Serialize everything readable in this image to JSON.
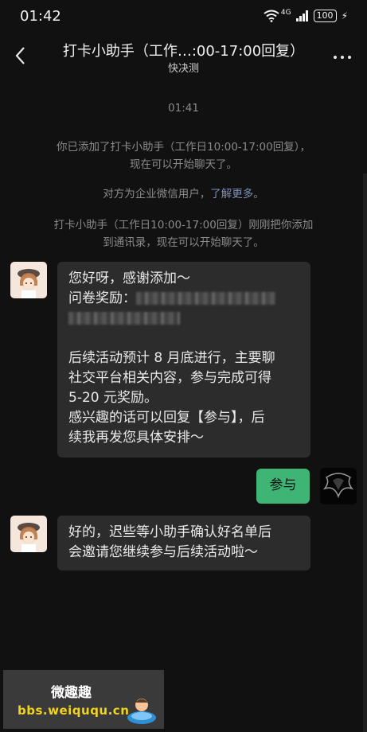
{
  "status": {
    "time": "01:42",
    "network": "4G",
    "battery": "100"
  },
  "header": {
    "title": "打卡小助手（工作…:00-17:00回复）",
    "subtitle": "快决测"
  },
  "chat": {
    "timestamp": "01:41",
    "sys1_line1": "你已添加了打卡小助手（工作日10:00-17:00回复），",
    "sys1_line2": "现在可以开始聊天了。",
    "sys2_prefix": "对方为企业微信用户，",
    "sys2_link": "了解更多",
    "sys2_suffix": "。",
    "sys3_line1": "打卡小助手（工作日10:00-17:00回复）刚刚把你添加",
    "sys3_line2": "到通讯录，现在可以开始聊天了。",
    "msg1": {
      "l1": "您好呀，感谢添加～",
      "l2": "问卷奖励：",
      "l3": "后续活动预计 8 月底进行，主要聊",
      "l4": "社交平台相关内容，参与完成可得",
      "l5": "5-20 元奖励。",
      "l6": "感兴趣的话可以回复【参与】，后",
      "l7": "续我再发您具体安排～"
    },
    "reply": "参与",
    "msg2": {
      "l1": "好的，迟些等小助手确认好名单后",
      "l2": "会邀请您继续参与后续活动啦～"
    }
  },
  "watermark": {
    "name": "微趣趣",
    "url": "bbs.weiququ.cn"
  }
}
